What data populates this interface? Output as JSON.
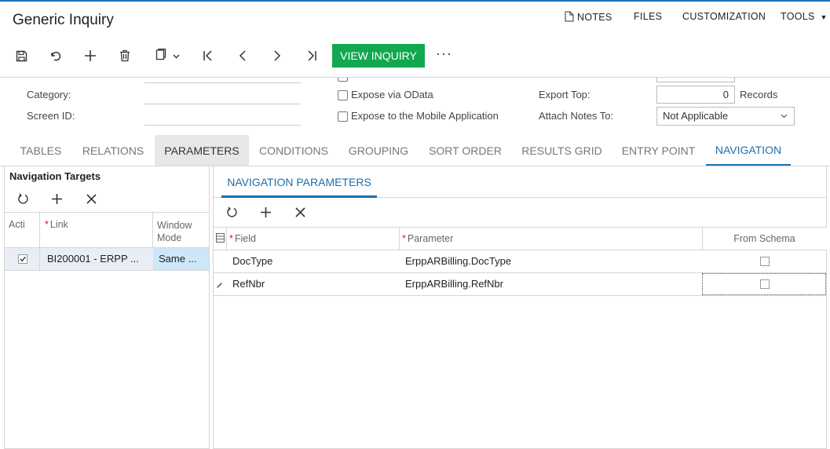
{
  "app": {
    "title": "Generic Inquiry"
  },
  "topmenu": {
    "notes": "NOTES",
    "files": "FILES",
    "customization": "CUSTOMIZATION",
    "tools": "TOOLS"
  },
  "toolbar": {
    "view_inquiry": "VIEW INQUIRY",
    "more": "···"
  },
  "accent_color": "#12a84f",
  "link_color": "#1b6fae",
  "form": {
    "category_label": "Category:",
    "category_value": "",
    "screen_id_label": "Screen ID:",
    "screen_id_value": "",
    "expose_odata_label": "Expose via OData",
    "expose_mobile_label": "Expose to the Mobile Application",
    "export_top_label": "Export Top:",
    "export_top_value": "0",
    "records_label": "Records",
    "attach_notes_label": "Attach Notes To:",
    "attach_notes_value": "Not Applicable"
  },
  "tabs": [
    "TABLES",
    "RELATIONS",
    "PARAMETERS",
    "CONDITIONS",
    "GROUPING",
    "SORT ORDER",
    "RESULTS GRID",
    "ENTRY POINT",
    "NAVIGATION"
  ],
  "navigation_targets": {
    "title": "Navigation Targets",
    "columns": {
      "active": "Acti",
      "link": "Link",
      "window_mode": "Window Mode"
    },
    "rows": [
      {
        "active": true,
        "link": "BI200001 - ERPP ...",
        "window_mode": "Same ..."
      }
    ]
  },
  "navigation_parameters": {
    "tab": "NAVIGATION PARAMETERS",
    "columns": {
      "field": "Field",
      "parameter": "Parameter",
      "from_schema": "From Schema"
    },
    "rows": [
      {
        "field": "DocType",
        "parameter": "ErppARBilling.DocType",
        "from_schema": false
      },
      {
        "field": "RefNbr",
        "parameter": "ErppARBilling.RefNbr",
        "from_schema": false
      }
    ]
  }
}
